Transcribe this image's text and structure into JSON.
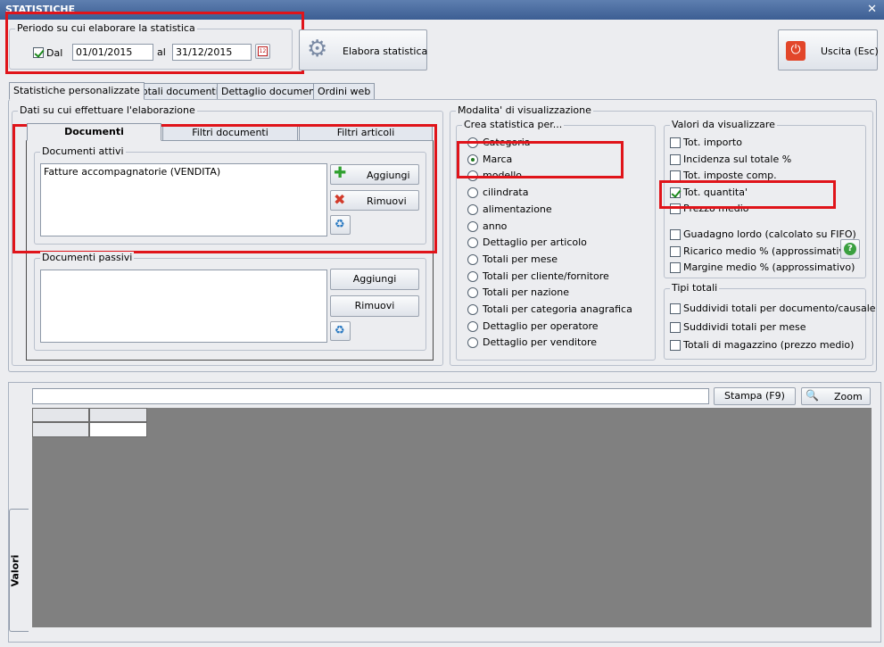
{
  "window": {
    "title": "STATISTICHE",
    "close_icon": "close-icon"
  },
  "periodo": {
    "legend": "Periodo su cui elaborare la statistica",
    "dal_label": "Dal",
    "dal_checked": true,
    "date_from": "01/01/2015",
    "al_label": "al",
    "date_to": "31/12/2015"
  },
  "toolbar": {
    "elabora_label": "Elabora statistica",
    "uscita_label": "Uscita (Esc)"
  },
  "main_tabs": [
    {
      "label": "Statistiche personalizzate"
    },
    {
      "label": "Totali documenti"
    },
    {
      "label": "Dettaglio documenti"
    },
    {
      "label": "Ordini web"
    }
  ],
  "dati": {
    "legend": "Dati su cui effettuare l'elaborazione",
    "tabs": [
      {
        "label": "Documenti"
      },
      {
        "label": "Filtri documenti"
      },
      {
        "label": "Filtri articoli"
      }
    ],
    "attivi": {
      "legend": "Documenti attivi",
      "items": [
        "Fatture accompagnatorie (VENDITA)"
      ],
      "add_label": "Aggiungi",
      "remove_label": "Rimuovi"
    },
    "passivi": {
      "legend": "Documenti passivi",
      "add_label": "Aggiungi",
      "remove_label": "Rimuovi"
    }
  },
  "modalita": {
    "legend": "Modalita' di visualizzazione",
    "crea": {
      "legend": "Crea statistica per...",
      "selected": "Marca",
      "options": [
        "Categoria",
        "Marca",
        "modello",
        "cilindrata",
        "alimentazione",
        "anno",
        "Dettaglio per articolo",
        "Totali per mese",
        "Totali per cliente/fornitore",
        "Totali per nazione",
        "Totali per categoria anagrafica",
        "Dettaglio per operatore",
        "Dettaglio per venditore"
      ]
    },
    "valori": {
      "legend": "Valori da visualizzare",
      "items": [
        {
          "label": "Tot. importo",
          "checked": false
        },
        {
          "label": "Incidenza sul totale %",
          "checked": false
        },
        {
          "label": "Tot. imposte comp.",
          "checked": false
        },
        {
          "label": "Tot. quantita'",
          "checked": true
        },
        {
          "label": "Prezzo medio",
          "checked": false
        }
      ],
      "items2": [
        {
          "label": "Guadagno lordo (calcolato su FIFO)",
          "checked": false
        },
        {
          "label": "Ricarico medio % (approssimativo)",
          "checked": false
        },
        {
          "label": "Margine medio % (approssimativo)",
          "checked": false
        }
      ]
    },
    "tipi": {
      "legend": "Tipi totali",
      "items": [
        {
          "label": "Suddividi totali per documento/causale",
          "checked": false
        },
        {
          "label": "Suddividi totali per mese",
          "checked": false
        },
        {
          "label": "Totali di magazzino (prezzo medio)",
          "checked": false
        }
      ]
    }
  },
  "results": {
    "search_value": "",
    "stampa_label": "Stampa (F9)",
    "zoom_label": "Zoom",
    "side_tab": "Valori"
  },
  "colors": {
    "highlight": "#e0141a",
    "grid_bg": "#808080",
    "title_bar": "#3c5e93"
  }
}
